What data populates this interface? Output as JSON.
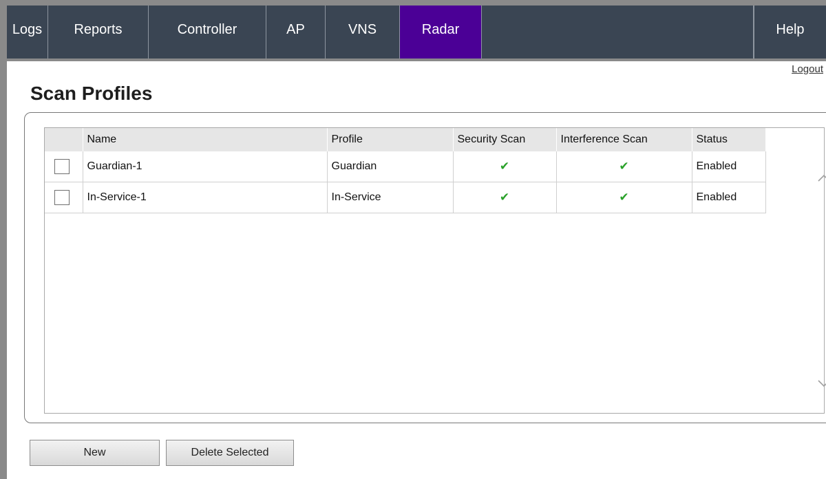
{
  "nav": {
    "tabs": [
      {
        "label": "Logs"
      },
      {
        "label": "Reports"
      },
      {
        "label": "Controller"
      },
      {
        "label": "AP"
      },
      {
        "label": "VNS"
      },
      {
        "label": "Radar"
      }
    ],
    "active_tab": "Radar",
    "help_label": "Help"
  },
  "logout_label": "Logout",
  "page_title": "Scan Profiles",
  "table": {
    "columns": [
      "Name",
      "Profile",
      "Security Scan",
      "Interference Scan",
      "Status"
    ],
    "rows": [
      {
        "name": "Guardian-1",
        "profile": "Guardian",
        "security_scan": true,
        "interference_scan": true,
        "status": "Enabled",
        "selected": false
      },
      {
        "name": "In-Service-1",
        "profile": "In-Service",
        "security_scan": true,
        "interference_scan": true,
        "status": "Enabled",
        "selected": false
      }
    ]
  },
  "buttons": {
    "new_label": "New",
    "delete_label": "Delete Selected"
  },
  "icons": {
    "check_mark": "check-icon",
    "scroll_up": "chevron-up-icon",
    "scroll_down": "chevron-down-icon"
  },
  "colors": {
    "nav_bg": "#3a4553",
    "active_tab_bg": "#4b0096",
    "check": "#2aa12a"
  }
}
